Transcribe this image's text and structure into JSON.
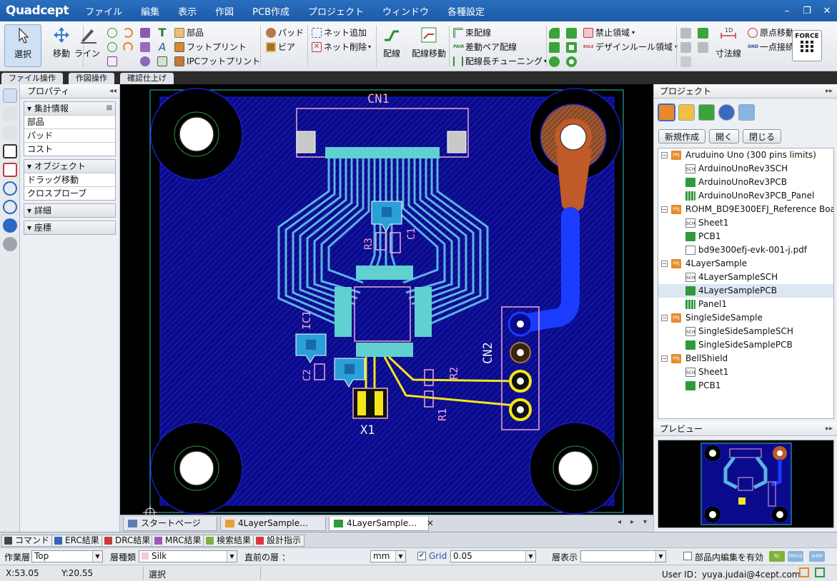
{
  "app": {
    "logo": "Quadcept",
    "menu": [
      "ファイル",
      "編集",
      "表示",
      "作図",
      "PCB作成",
      "プロジェクト",
      "ウィンドウ",
      "各種設定"
    ],
    "window_controls": [
      "–",
      "❐",
      "✕"
    ]
  },
  "ribbon": {
    "select": "選択",
    "move": "移動",
    "line": "ライン",
    "part": "部品",
    "footprint": "フットプリント",
    "ipc_footprint": "IPCフットプリント",
    "pad": "パッド",
    "via": "ビア",
    "net_add": "ネット追加",
    "net_delete": "ネット削除",
    "wiring": "配線",
    "wiring_move": "配線移動",
    "bundle_wiring": "束配線",
    "diff_pair_wiring": "差動ペア配線",
    "length_tuning": "配線長チューニング",
    "keepout_area": "禁止領域",
    "design_rule_area": "デザインルール領域",
    "dimension": "寸法線",
    "origin_move": "原点移動",
    "single_point_connect": "一点接続",
    "force": "FORCE",
    "icon_labels": {
      "pair": "PAIR",
      "rule": "RULE",
      "gnd": "GND",
      "dimension": "1D"
    }
  },
  "ribbon_tabs": [
    "ファイル操作",
    "作図操作",
    "確認仕上げ"
  ],
  "properties": {
    "title": "プロパティ",
    "collapse_glyph": "◂◂",
    "sections": [
      {
        "title": "集計情報",
        "pinned": true,
        "items": [
          "部品",
          "パッド",
          "コスト"
        ]
      },
      {
        "title": "オブジェクト",
        "pinned": false,
        "items": [
          "ドラッグ移動",
          "クロスプローブ"
        ]
      },
      {
        "title": "詳細",
        "pinned": false,
        "items": []
      },
      {
        "title": "座標",
        "pinned": false,
        "items": []
      }
    ]
  },
  "pcb": {
    "labels": {
      "cn1": "CN1",
      "cn2": "CN2",
      "r3": "R3",
      "c1": "C1",
      "ic1": "IC1",
      "c2": "C2",
      "r2": "R2",
      "r1": "R1",
      "x1": "X1"
    }
  },
  "doc_tabs": [
    {
      "label": "スタートページ",
      "active": false,
      "icon_color": "#5b7fb5",
      "closable": false
    },
    {
      "label": "4LayerSample…",
      "active": false,
      "icon_color": "#e8a03a",
      "closable": false
    },
    {
      "label": "4LayerSample…",
      "active": true,
      "icon_color": "#2e9a3a",
      "closable": true
    }
  ],
  "doc_tab_nav": [
    "◂",
    "▸",
    "▾"
  ],
  "project": {
    "title": "プロジェクト",
    "expand_glyph": "▸▸",
    "buttons": [
      "新規作成",
      "開く",
      "閉じる"
    ],
    "tree": [
      {
        "label": "Aruduino Uno (300 pins limits)",
        "level": 0,
        "type": "prj"
      },
      {
        "label": "ArduinoUnoRev3SCH",
        "level": 1,
        "type": "sch"
      },
      {
        "label": "ArduinoUnoRev3PCB",
        "level": 1,
        "type": "pcb"
      },
      {
        "label": "ArduinoUnoRev3PCB_Panel",
        "level": 1,
        "type": "panel"
      },
      {
        "label": "ROHM_BD9E300EFJ_Reference Board",
        "level": 0,
        "type": "prj"
      },
      {
        "label": "Sheet1",
        "level": 1,
        "type": "sch"
      },
      {
        "label": "PCB1",
        "level": 1,
        "type": "pcb"
      },
      {
        "label": "bd9e300efj-evk-001-j.pdf",
        "level": 1,
        "type": "pdf"
      },
      {
        "label": "4LayerSample",
        "level": 0,
        "type": "prj"
      },
      {
        "label": "4LayerSampleSCH",
        "level": 1,
        "type": "sch"
      },
      {
        "label": "4LayerSamplePCB",
        "level": 1,
        "type": "pcb",
        "selected": true
      },
      {
        "label": "Panel1",
        "level": 1,
        "type": "panel"
      },
      {
        "label": "SingleSideSample",
        "level": 0,
        "type": "prj"
      },
      {
        "label": "SingleSideSampleSCH",
        "level": 1,
        "type": "sch"
      },
      {
        "label": "SingleSideSamplePCB",
        "level": 1,
        "type": "pcb"
      },
      {
        "label": "BellShield",
        "level": 0,
        "type": "prj"
      },
      {
        "label": "Sheet1",
        "level": 1,
        "type": "sch"
      },
      {
        "label": "PCB1",
        "level": 1,
        "type": "pcb"
      }
    ],
    "icon_text": {
      "prj": "PRJ",
      "sch": "SCH",
      "pcb": "",
      "panel": "",
      "pdf": ""
    }
  },
  "preview": {
    "title": "プレビュー"
  },
  "bottom_tabs": [
    {
      "label": "コマンド",
      "color": "#444444"
    },
    {
      "label": "ERC結果",
      "color": "#3464b8"
    },
    {
      "label": "DRC結果",
      "color": "#c73a3a"
    },
    {
      "label": "MRC結果",
      "color": "#9b59b6"
    },
    {
      "label": "検索結果",
      "color": "#7fb23a"
    },
    {
      "label": "設計指示",
      "color": "#d9383a"
    }
  ],
  "options": {
    "work_layer_label": "作業層",
    "work_layer_value": "Top",
    "layer_type_label": "層種類",
    "layer_type_value": "Silk",
    "prev_layer_label": "直前の層 ：",
    "unit_value": "mm",
    "grid_label": "Grid",
    "grid_value": "0.05",
    "grid_checked": true,
    "layer_display_label": "層表示",
    "layer_display_value": "",
    "part_edit_label": "部品内編集を有効",
    "part_edit_checked": false,
    "mini_labels": [
      "RC",
      "PRESS",
      "SHRP"
    ]
  },
  "status": {
    "x": "X:53.05",
    "y": "Y:20.55",
    "mode": "選択",
    "user": "User ID：yuya.judai@4cept.com"
  },
  "colors": {
    "title_bar": "#1c5aa5",
    "board": "#0a0a8c",
    "copper_trace": "#5ab4e0",
    "silk": "#f0a8d0",
    "pad_yellow": "#f5e61a",
    "copper_pour": "#c05a28",
    "selected_blue": "#1a3cff"
  }
}
